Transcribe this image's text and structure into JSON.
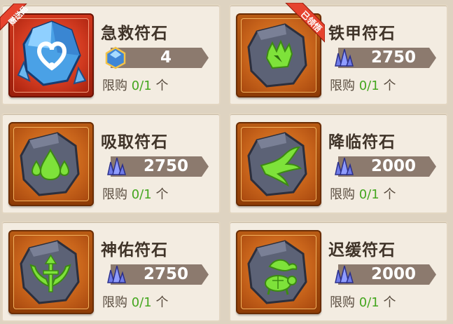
{
  "cards": [
    {
      "title": "急救符石",
      "price": "4",
      "limit_label": "限购",
      "limit_count": "0/1",
      "limit_unit": "个",
      "badge": "赠送品",
      "currency": "blue-gem"
    },
    {
      "title": "铁甲符石",
      "price": "2750",
      "limit_label": "限购",
      "limit_count": "0/1",
      "limit_unit": "个",
      "badge": "已领悟",
      "currency": "crystal"
    },
    {
      "title": "吸取符石",
      "price": "2750",
      "limit_label": "限购",
      "limit_count": "0/1",
      "limit_unit": "个",
      "currency": "crystal"
    },
    {
      "title": "降临符石",
      "price": "2000",
      "limit_label": "限购",
      "limit_count": "0/1",
      "limit_unit": "个",
      "currency": "crystal"
    },
    {
      "title": "神佑符石",
      "price": "2750",
      "limit_label": "限购",
      "limit_count": "0/1",
      "limit_unit": "个",
      "currency": "crystal"
    },
    {
      "title": "迟缓符石",
      "price": "2000",
      "limit_label": "限购",
      "limit_count": "0/1",
      "limit_unit": "个",
      "currency": "crystal"
    }
  ],
  "colors": {
    "accent_green": "#44a61f",
    "price_bar": "#8c7a6e",
    "frame_orange": "#c8641b",
    "frame_red": "#d13a20"
  }
}
